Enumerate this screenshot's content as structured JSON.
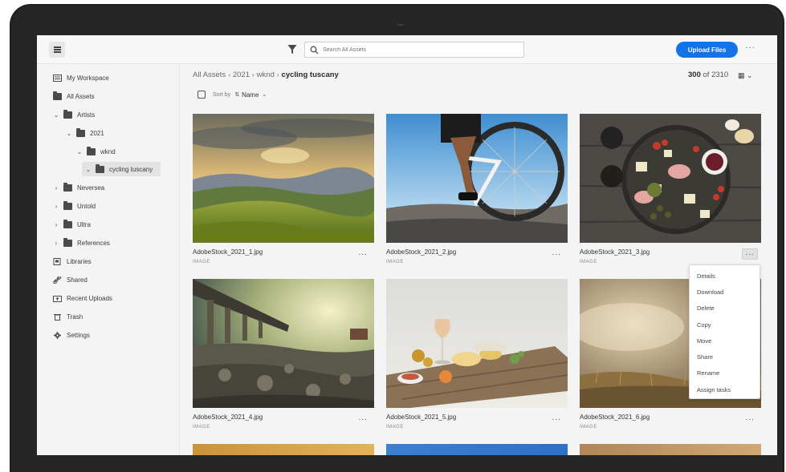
{
  "topbar": {
    "menu_icon": "hamburger-icon",
    "filter_icon": "filter-icon",
    "search_placeholder": "Search All Assets",
    "upload_label": "Upload Files",
    "more_label": "···",
    "accent_color": "#1473e6"
  },
  "sidebar": {
    "items": [
      {
        "label": "My Workspace",
        "icon": "workspace-icon"
      },
      {
        "label": "All Assets",
        "icon": "folder-icon"
      },
      {
        "label": "Artists",
        "icon": "folder-icon",
        "expanded": true
      },
      {
        "label": "2021",
        "icon": "folder-icon",
        "expanded": true
      },
      {
        "label": "wknd",
        "icon": "folder-icon",
        "expanded": true
      },
      {
        "label": "cycling tuscany",
        "icon": "folder-icon",
        "selected": true
      },
      {
        "label": "Neversea",
        "icon": "folder-icon"
      },
      {
        "label": "Untold",
        "icon": "folder-icon"
      },
      {
        "label": "Ultra",
        "icon": "folder-icon"
      },
      {
        "label": "References",
        "icon": "folder-icon"
      },
      {
        "label": "Libraries",
        "icon": "libraries-icon"
      },
      {
        "label": "Shared",
        "icon": "link-icon"
      },
      {
        "label": "Recent Uploads",
        "icon": "upload-folder-icon"
      },
      {
        "label": "Trash",
        "icon": "trash-icon"
      },
      {
        "label": "Settings",
        "icon": "gear-icon"
      }
    ]
  },
  "breadcrumb": {
    "items": [
      "All Assets",
      "2021",
      "wknd"
    ],
    "current": "cycling tuscany"
  },
  "count": {
    "shown": "300",
    "of_label": "of",
    "total": "2310"
  },
  "sort": {
    "label": "Sort by",
    "value": "Name"
  },
  "assets": [
    {
      "name": "AdobeStock_2021_1.jpg",
      "type": "IMAGE"
    },
    {
      "name": "AdobeStock_2021_2.jpg",
      "type": "IMAGE"
    },
    {
      "name": "AdobeStock_2021_3.jpg",
      "type": "IMAGE"
    },
    {
      "name": "AdobeStock_2021_4.jpg",
      "type": "IMAGE"
    },
    {
      "name": "AdobeStock_2021_5.jpg",
      "type": "IMAGE"
    },
    {
      "name": "AdobeStock_2021_6.jpg",
      "type": "IMAGE"
    }
  ],
  "card_more_label": "···",
  "context_menu": {
    "items": [
      "Details",
      "Download",
      "Delete",
      "Copy",
      "Move",
      "Share",
      "Rename",
      "Assign tasks"
    ]
  }
}
